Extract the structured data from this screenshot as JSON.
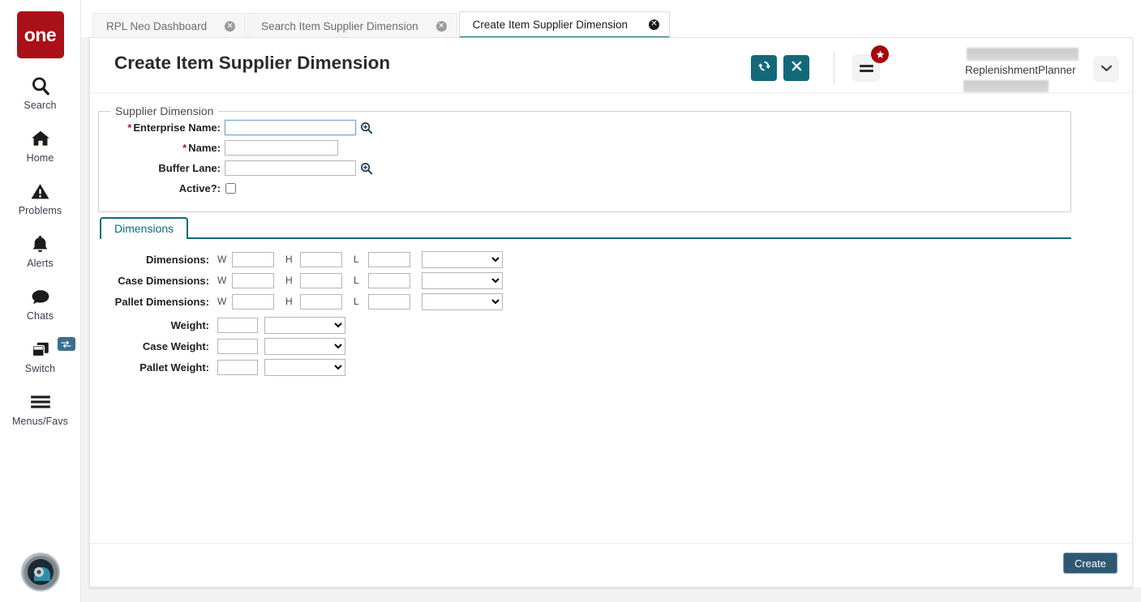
{
  "brand": {
    "logo_text": "one"
  },
  "sidebar": {
    "items": [
      {
        "label": "Search",
        "icon": "search-icon"
      },
      {
        "label": "Home",
        "icon": "home-icon"
      },
      {
        "label": "Problems",
        "icon": "warning-triangle-icon"
      },
      {
        "label": "Alerts",
        "icon": "bell-icon"
      },
      {
        "label": "Chats",
        "icon": "chat-bubble-icon"
      },
      {
        "label": "Switch",
        "icon": "windows-stack-icon",
        "badge_icon": "swap-arrows-icon"
      },
      {
        "label": "Menus/Favs",
        "icon": "hamburger-icon"
      }
    ],
    "avatar_name": "user-avatar"
  },
  "tabs": [
    {
      "label": "RPL Neo Dashboard",
      "active": false
    },
    {
      "label": "Search Item Supplier Dimension",
      "active": false
    },
    {
      "label": "Create Item Supplier Dimension",
      "active": true
    }
  ],
  "header": {
    "title": "Create Item Supplier Dimension",
    "refresh_icon": "refresh-icon",
    "close_icon": "close-x-icon",
    "menu_icon": "list-menu-icon",
    "badge_icon": "star-icon",
    "user_role": "ReplenishmentPlanner",
    "chevron_icon": "chevron-down-icon"
  },
  "form": {
    "group_legend": "Supplier Dimension",
    "fields": [
      {
        "label": "Enterprise Name",
        "required": true,
        "value": "",
        "lookup": true,
        "focused": true
      },
      {
        "label": "Name",
        "required": true,
        "value": "",
        "lookup": false,
        "focused": false
      },
      {
        "label": "Buffer Lane",
        "required": false,
        "value": "",
        "lookup": true,
        "focused": false
      }
    ],
    "active_label": "Active?",
    "active_checked": false
  },
  "tabpanel": {
    "tabs": [
      {
        "label": "Dimensions",
        "active": true
      }
    ],
    "axis_labels": {
      "w": "W",
      "h": "H",
      "l": "L"
    },
    "dimension_rows": [
      {
        "label": "Dimensions",
        "w": "",
        "h": "",
        "l": "",
        "uom": ""
      },
      {
        "label": "Case Dimensions",
        "w": "",
        "h": "",
        "l": "",
        "uom": ""
      },
      {
        "label": "Pallet Dimensions",
        "w": "",
        "h": "",
        "l": "",
        "uom": ""
      }
    ],
    "weight_rows": [
      {
        "label": "Weight",
        "value": "",
        "uom": ""
      },
      {
        "label": "Case Weight",
        "value": "",
        "uom": ""
      },
      {
        "label": "Pallet Weight",
        "value": "",
        "uom": ""
      }
    ]
  },
  "footer": {
    "create_label": "Create"
  },
  "colors": {
    "brand_red": "#a91018",
    "teal": "#0f6b7a",
    "button_teal": "#13697a",
    "create_blue": "#2f5872",
    "badge_red": "#a4060c",
    "required_red": "#9c1f1f"
  }
}
